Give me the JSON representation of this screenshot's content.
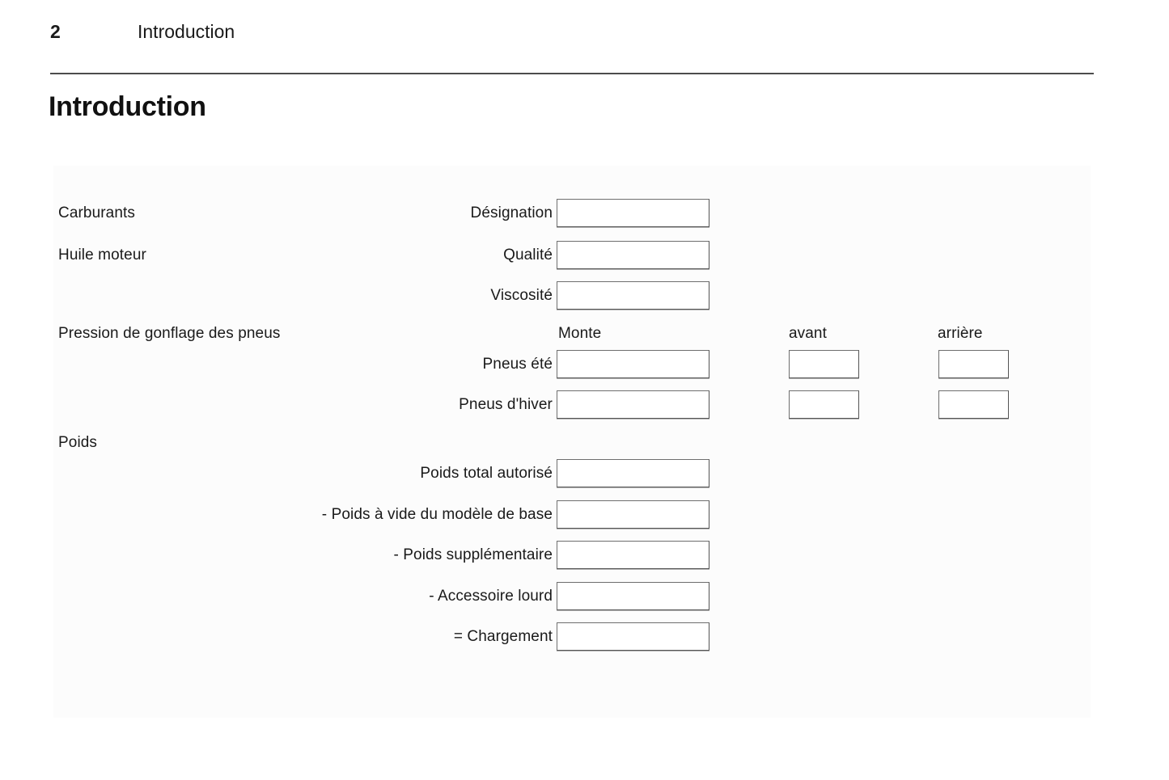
{
  "header": {
    "page_number": "2",
    "running_title": "Introduction"
  },
  "section": {
    "heading": "Introduction"
  },
  "form": {
    "groups": [
      {
        "label": "Carburants"
      },
      {
        "label": "Huile moteur"
      },
      {
        "label": "Pression de gonflage des pneus"
      },
      {
        "label": "Poids"
      }
    ],
    "tire_columns": {
      "monte": "Monte",
      "front": "avant",
      "rear": "arrière"
    },
    "fields": [
      {
        "label": "Désignation",
        "value": "",
        "placeholder": ""
      },
      {
        "label": "Qualité",
        "value": "",
        "placeholder": ""
      },
      {
        "label": "Viscosité",
        "value": "",
        "placeholder": ""
      },
      {
        "label": "Pneus été",
        "value": "",
        "front": "",
        "rear": "",
        "placeholder": ""
      },
      {
        "label": "Pneus d'hiver",
        "value": "",
        "front": "",
        "rear": "",
        "placeholder": ""
      },
      {
        "label": "Poids total autorisé",
        "value": "",
        "placeholder": ""
      },
      {
        "label": "- Poids à vide du modèle de base",
        "value": "",
        "placeholder": ""
      },
      {
        "label": "- Poids supplémentaire",
        "value": "",
        "placeholder": ""
      },
      {
        "label": "- Accessoire lourd",
        "value": "",
        "placeholder": ""
      },
      {
        "label": "= Chargement",
        "value": "",
        "placeholder": ""
      }
    ]
  }
}
